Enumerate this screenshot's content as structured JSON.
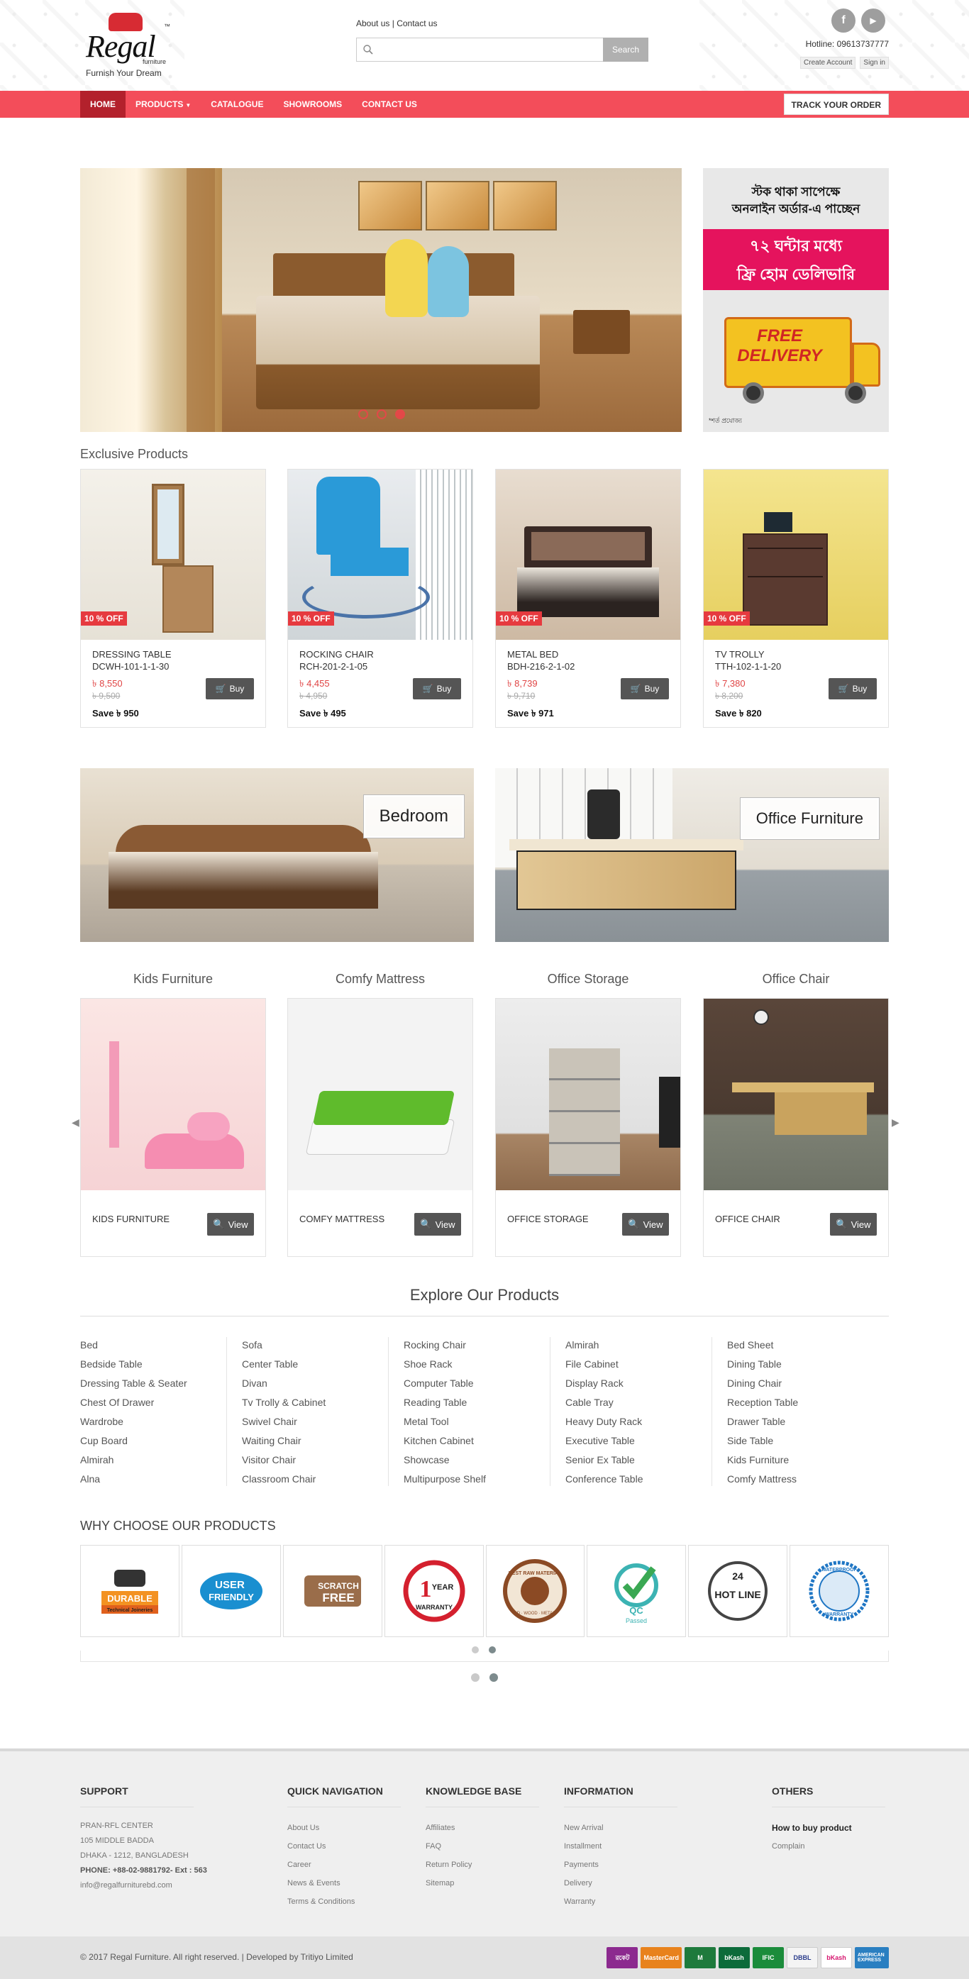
{
  "header": {
    "brand": "Regal",
    "brand_sub": "furniture",
    "tagline": "Furnish Your Dream",
    "about": "About us",
    "divider": "|",
    "contact": "Contact us",
    "search_placeholder": "",
    "search_button": "Search",
    "hotline": "Hotline: 09613737777",
    "create_account": "Create Account",
    "sign_in": "Sign in",
    "social": [
      "f",
      "▶"
    ]
  },
  "nav": {
    "items": [
      "HOME",
      "PRODUCTS",
      "CATALOGUE",
      "SHOWROOMS",
      "CONTACT US"
    ],
    "track": "TRACK YOUR ORDER"
  },
  "promo": {
    "line1": "স্টক থাকা সাপেক্ষে",
    "line2": "অনলাইন অর্ডার-এ পাচ্ছেন",
    "band1": "৭২ ঘন্টার মধ্যে",
    "band2": "ফ্রি হোম ডেলিভারি",
    "free": "FREE",
    "delivery": "DELIVERY",
    "fine": "*শর্ত প্রযোজ্য"
  },
  "exclusive": {
    "title": "Exclusive Products",
    "products": [
      {
        "discount": "10 % OFF",
        "name": "DRESSING TABLE",
        "code": "DCWH-101-1-1-30",
        "price": "৳ 8,550",
        "old_price": "৳ 9,500",
        "save_label": "Save",
        "save": "৳ 950",
        "buy": "Buy"
      },
      {
        "discount": "10 % OFF",
        "name": "ROCKING CHAIR",
        "code": "RCH-201-2-1-05",
        "price": "৳ 4,455",
        "old_price": "৳ 4,950",
        "save_label": "Save",
        "save": "৳ 495",
        "buy": "Buy"
      },
      {
        "discount": "10 % OFF",
        "name": "METAL BED",
        "code": "BDH-216-2-1-02",
        "price": "৳ 8,739",
        "old_price": "৳ 9,710",
        "save_label": "Save",
        "save": "৳ 971",
        "buy": "Buy"
      },
      {
        "discount": "10 % OFF",
        "name": "TV TROLLY",
        "code": "TTH-102-1-1-20",
        "price": "৳ 7,380",
        "old_price": "৳ 8,200",
        "save_label": "Save",
        "save": "৳ 820",
        "buy": "Buy"
      }
    ]
  },
  "banners": [
    "Bedroom",
    "Office Furniture"
  ],
  "showcase": [
    {
      "title": "Kids Furniture",
      "name": "KIDS FURNITURE",
      "view": "View"
    },
    {
      "title": "Comfy Mattress",
      "name": "COMFY MATTRESS",
      "view": "View"
    },
    {
      "title": "Office Storage",
      "name": "OFFICE STORAGE",
      "view": "View"
    },
    {
      "title": "Office Chair",
      "name": "OFFICE CHAIR",
      "view": "View"
    }
  ],
  "explore": {
    "title": "Explore Our Products",
    "columns": [
      [
        "Bed",
        "Bedside Table",
        "Dressing Table & Seater",
        "Chest Of Drawer",
        "Wardrobe",
        "Cup Board",
        "Almirah",
        "Alna"
      ],
      [
        "Sofa",
        "Center Table",
        "Divan",
        "Tv Trolly & Cabinet",
        "Swivel Chair",
        "Waiting Chair",
        "Visitor Chair",
        "Classroom Chair"
      ],
      [
        "Rocking Chair",
        "Shoe Rack",
        "Computer Table",
        "Reading Table",
        "Metal Tool",
        "Kitchen Cabinet",
        "Showcase",
        "Multipurpose Shelf"
      ],
      [
        "Almirah",
        "File Cabinet",
        "Display Rack",
        "Cable Tray",
        "Heavy Duty Rack",
        "Executive Table",
        "Senior Ex Table",
        "Conference Table"
      ],
      [
        "Bed Sheet",
        "Dining Table",
        "Dining Chair",
        "Reception Table",
        "Drawer Table",
        "Side Table",
        "Kids Furniture",
        "Comfy Mattress"
      ]
    ]
  },
  "why": {
    "title": "WHY CHOOSE OUR PRODUCTS",
    "badges": [
      {
        "icon": "durable-icon",
        "text1": "DURABLE",
        "text2": "Technical Joineries"
      },
      {
        "icon": "user-friendly-icon",
        "text1": "USER",
        "text2": "FRIENDLY"
      },
      {
        "icon": "scratch-free-icon",
        "text1": "SCRATCH",
        "text2": "FREE"
      },
      {
        "icon": "warranty-icon",
        "text1": "1",
        "text2": "YEAR",
        "text3": "WARRANTY"
      },
      {
        "icon": "raw-material-icon",
        "text1": "BEST RAW MATERIAL",
        "text2": "LD · WOOD · METAL"
      },
      {
        "icon": "qc-passed-icon",
        "text1": "QC",
        "text2": "Passed"
      },
      {
        "icon": "hotline-icon",
        "text1": "24",
        "text2": "HOT LINE"
      },
      {
        "icon": "waterproof-icon",
        "text1": "WATERPROOF",
        "text2": "WARRANTY"
      }
    ]
  },
  "footer": {
    "support": {
      "heading": "SUPPORT",
      "lines": [
        "PRAN-RFL CENTER",
        "105 MIDDLE BADDA",
        "DHAKA - 1212, BANGLADESH"
      ],
      "phone_label": "PHONE:",
      "phone": "+88-02-9881792- Ext : 563",
      "email": "info@regalfurniturebd.com"
    },
    "quick": {
      "heading": "QUICK NAVIGATION",
      "links": [
        "About Us",
        "Contact Us",
        "Career",
        "News & Events",
        "Terms & Conditions"
      ]
    },
    "knowledge": {
      "heading": "KNOWLEDGE BASE",
      "links": [
        "Affiliates",
        "FAQ",
        "Return Policy",
        "Sitemap"
      ]
    },
    "information": {
      "heading": "INFORMATION",
      "links": [
        "New Arrival",
        "Installment",
        "Payments",
        "Delivery",
        "Warranty"
      ]
    },
    "others": {
      "heading": "OTHERS",
      "strong": "How to buy product",
      "links": [
        "Complain"
      ]
    }
  },
  "bottom": {
    "copyright": "© 2017 Regal Furniture. All right reserved. | Developed by",
    "developer": "Tritiyo Limited",
    "payments": [
      "রকেট",
      "MasterCard",
      "M",
      "bKash",
      "IFIC",
      "DBBL",
      "bKash",
      "AMERICAN EXPRESS"
    ]
  },
  "colors": {
    "nav": "#f34d5a",
    "nav_active": "#b3212c",
    "discount": "#e63a3f",
    "price": "#e04545"
  }
}
